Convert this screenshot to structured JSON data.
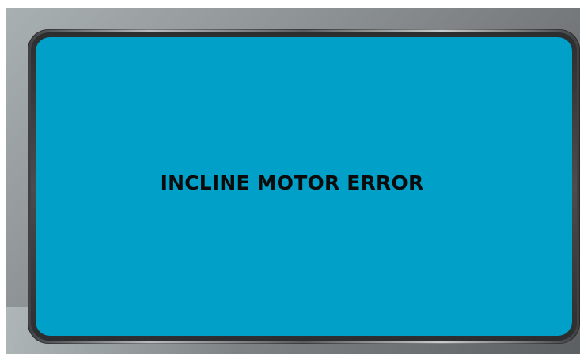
{
  "display": {
    "message": "INCLINE MOTOR ERROR",
    "background_color": "#00a0c8",
    "text_color": "#0b0b0b"
  }
}
